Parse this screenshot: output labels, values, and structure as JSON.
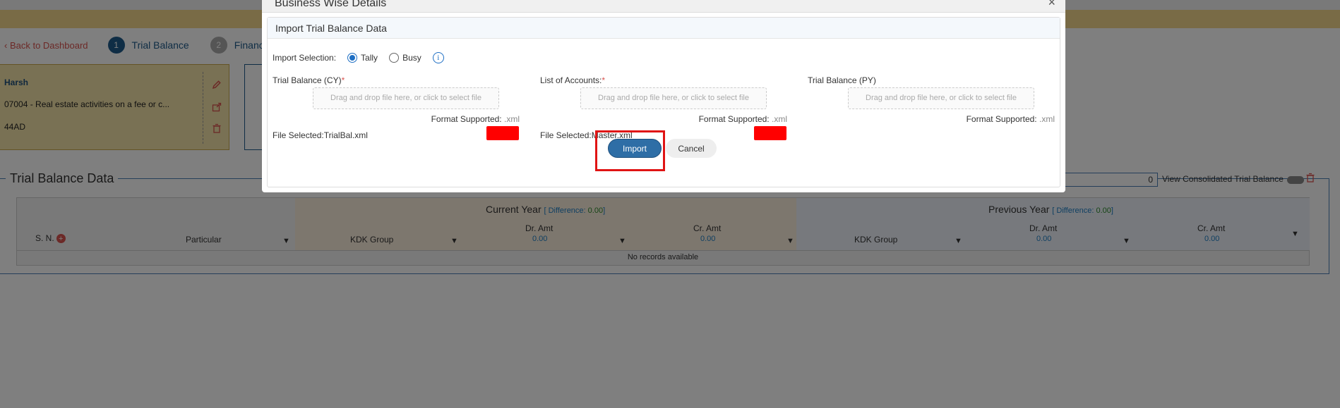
{
  "background": {
    "breadcrumb": {
      "back_link": "Back to Dashboard",
      "steps": [
        {
          "num": "1",
          "label": "Trial Balance"
        },
        {
          "num": "2",
          "label": "Financi"
        }
      ]
    },
    "client_card": {
      "name": "Harsh",
      "activity": "07004 - Real estate activities on a fee or c...",
      "code": "44AD"
    },
    "trial_balance": {
      "legend": "Trial Balance Data",
      "search_value": "0",
      "consolidated_label": "View Consolidated Trial Balance",
      "current_year": {
        "title": "Current Year",
        "diff_prefix": "[ Difference: ",
        "diff_value": "0.00",
        "diff_suffix": "]"
      },
      "previous_year": {
        "title": "Previous Year",
        "diff_prefix": "[ Difference: ",
        "diff_value": "0.00",
        "diff_suffix": "]"
      },
      "columns": {
        "sn": "S. N.",
        "particular": "Particular",
        "kdk_group": "KDK Group",
        "dr_amt": "Dr. Amt",
        "cr_amt": "Cr. Amt",
        "cy_dr_total": "0.00",
        "cy_cr_total": "0.00",
        "py_dr_total": "0.00",
        "py_cr_total": "0.00"
      },
      "empty_message": "No records available"
    }
  },
  "modal": {
    "title": "Business Wise Details",
    "close": "×",
    "section_title": "Import Trial Balance Data",
    "import_selection": {
      "label": "Import Selection:",
      "options": [
        {
          "label": "Tally",
          "checked": true
        },
        {
          "label": "Busy",
          "checked": false
        }
      ]
    },
    "uploads": [
      {
        "label": "Trial Balance (CY)",
        "required": "*",
        "dropzone": "Drag and drop file here, or click to select file",
        "format_label": "Format Supported:",
        "format_ext": " .xml",
        "file_selected": "File Selected:TrialBal.xml"
      },
      {
        "label": "List of Accounts:",
        "required": "*",
        "dropzone": "Drag and drop file here, or click to select file",
        "format_label": "Format Supported:",
        "format_ext": " .xml",
        "file_selected": "File Selected:Master.xml"
      },
      {
        "label": "Trial Balance (PY)",
        "required": "",
        "dropzone": "Drag and drop file here, or click to select file",
        "format_label": "Format Supported:",
        "format_ext": " .xml",
        "file_selected": ""
      }
    ],
    "buttons": {
      "import": "Import",
      "cancel": "Cancel"
    }
  },
  "colors": {
    "accent": "#2e6ea6",
    "highlight": "#e01414",
    "banner": "#f2d78c",
    "danger": "#d9534f"
  }
}
